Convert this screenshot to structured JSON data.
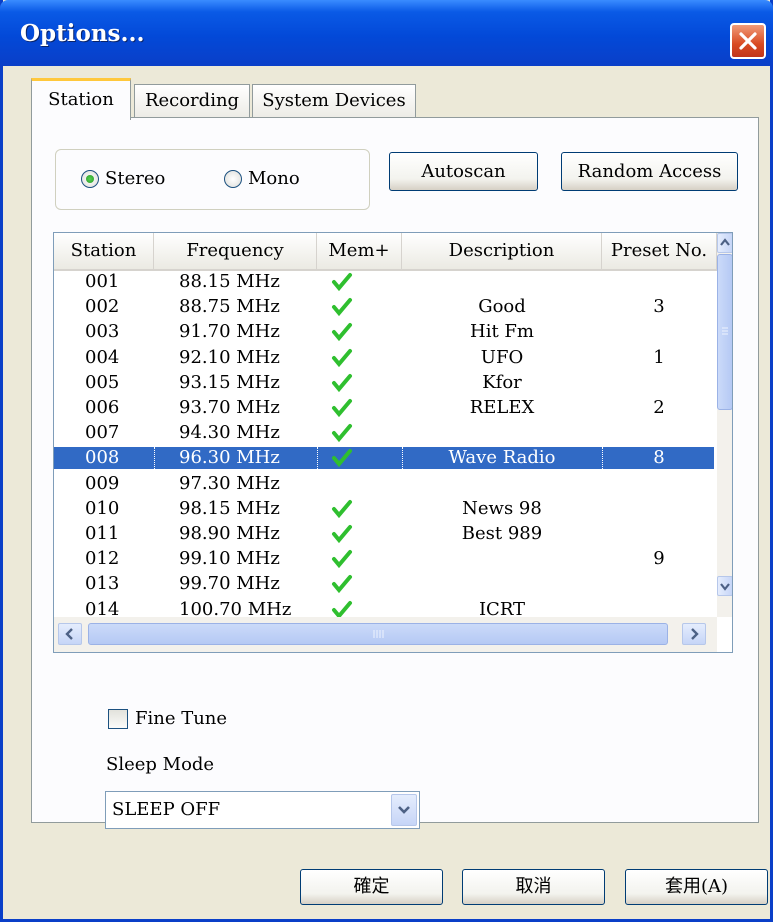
{
  "window": {
    "title": "Options..."
  },
  "tabs": [
    {
      "label": "Station",
      "active": true
    },
    {
      "label": "Recording",
      "active": false
    },
    {
      "label": "System Devices",
      "active": false
    }
  ],
  "station": {
    "mode": {
      "options": [
        "Stereo",
        "Mono"
      ],
      "selected": "Stereo"
    },
    "autoscan_label": "Autoscan",
    "random_access_label": "Random Access",
    "columns": [
      "Station",
      "Frequency",
      "Mem+",
      "Description",
      "Preset No."
    ],
    "rows": [
      {
        "station": "001",
        "frequency": "88.15 MHz",
        "mem": true,
        "description": "",
        "preset": ""
      },
      {
        "station": "002",
        "frequency": "88.75 MHz",
        "mem": true,
        "description": "Good",
        "preset": "3"
      },
      {
        "station": "003",
        "frequency": "91.70 MHz",
        "mem": true,
        "description": "Hit Fm",
        "preset": ""
      },
      {
        "station": "004",
        "frequency": "92.10 MHz",
        "mem": true,
        "description": "UFO",
        "preset": "1"
      },
      {
        "station": "005",
        "frequency": "93.15 MHz",
        "mem": true,
        "description": "Kfor",
        "preset": ""
      },
      {
        "station": "006",
        "frequency": "93.70 MHz",
        "mem": true,
        "description": "RELEX",
        "preset": "2"
      },
      {
        "station": "007",
        "frequency": "94.30 MHz",
        "mem": true,
        "description": "",
        "preset": ""
      },
      {
        "station": "008",
        "frequency": "96.30 MHz",
        "mem": true,
        "description": "Wave Radio",
        "preset": "8",
        "selected": true
      },
      {
        "station": "009",
        "frequency": "97.30 MHz",
        "mem": false,
        "description": "",
        "preset": ""
      },
      {
        "station": "010",
        "frequency": "98.15 MHz",
        "mem": true,
        "description": "News 98",
        "preset": ""
      },
      {
        "station": "011",
        "frequency": "98.90 MHz",
        "mem": true,
        "description": "Best 989",
        "preset": ""
      },
      {
        "station": "012",
        "frequency": "99.10 MHz",
        "mem": true,
        "description": "",
        "preset": "9"
      },
      {
        "station": "013",
        "frequency": "99.70 MHz",
        "mem": true,
        "description": "",
        "preset": ""
      },
      {
        "station": "014",
        "frequency": "100.70 MHz",
        "mem": true,
        "description": "ICRT",
        "preset": ""
      }
    ],
    "fine_tune_label": "Fine Tune",
    "fine_tune_checked": false,
    "sleep_mode_label": "Sleep Mode",
    "sleep_mode_value": "SLEEP OFF"
  },
  "footer": {
    "ok_label": "確定",
    "cancel_label": "取消",
    "apply_label": "套用(A)"
  },
  "colors": {
    "title_bar": "#0a5ae6",
    "selection": "#316ac5",
    "check": "#2fbf2f",
    "close": "#d94a21"
  }
}
